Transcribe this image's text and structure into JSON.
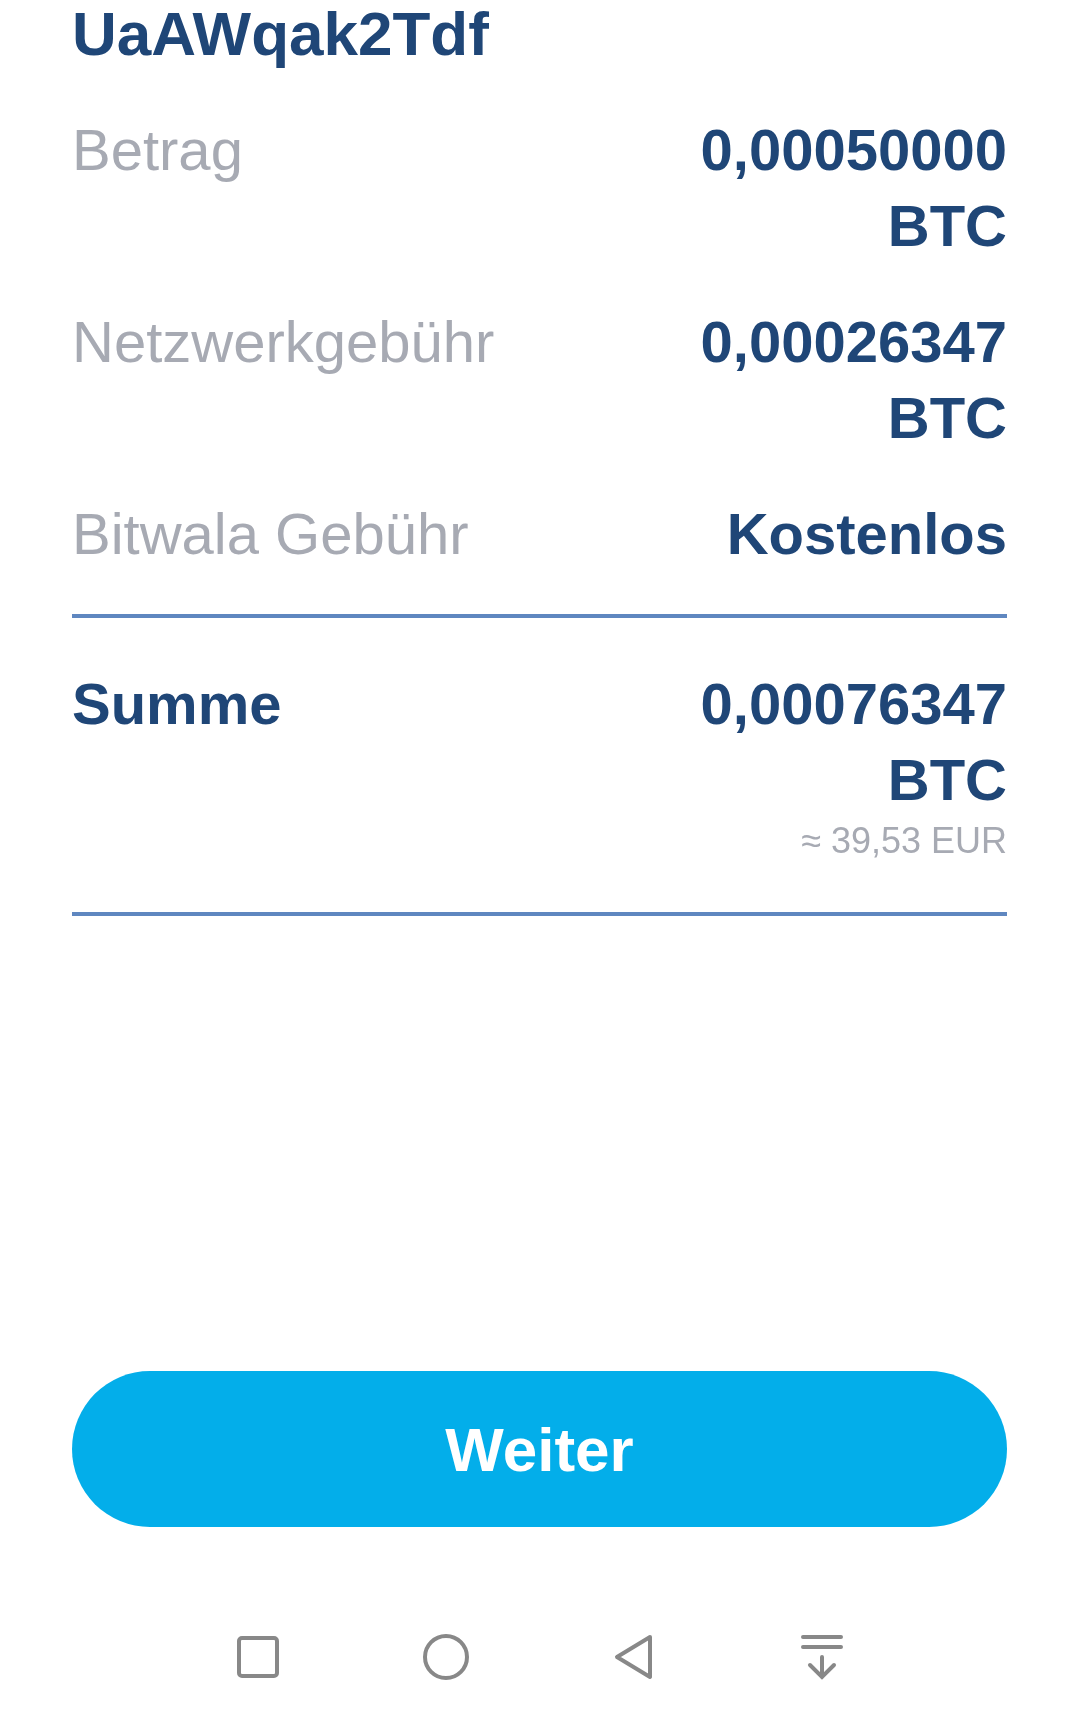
{
  "address_tail": "UaAWqak2Tdf",
  "rows": [
    {
      "label": "Betrag",
      "value": "0,00050000 BTC"
    },
    {
      "label": "Netzwerkgebühr",
      "value": "0,00026347 BTC"
    },
    {
      "label": "Bitwala Gebühr",
      "value": "Kostenlos"
    }
  ],
  "total": {
    "label": "Summe",
    "value": "0,00076347 BTC",
    "approx": "≈ 39,53 EUR"
  },
  "button": "Weiter"
}
